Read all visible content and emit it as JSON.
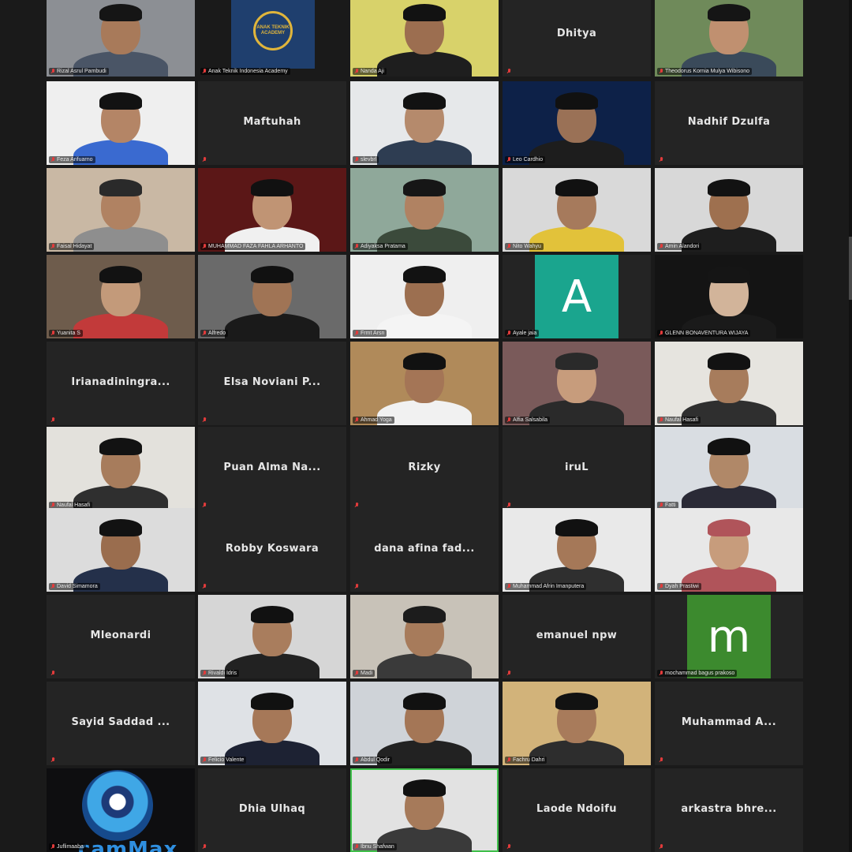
{
  "gallery": {
    "participants": [
      {
        "name": "Rizal Asrul Pambudi",
        "video": true,
        "bg": "#8c8f94",
        "skin": "#a87a5a",
        "shirt": "#4a5566",
        "hair": "#151515"
      },
      {
        "name": "Anak Teknik Indonesia Academy",
        "video": true,
        "logo": true,
        "logo_text": "ANAK TEKNIK ACADEMY",
        "bg": "#1a1a1a"
      },
      {
        "name": "Nanda Aji",
        "video": true,
        "bg": "#d8d26a",
        "skin": "#9c6e50",
        "shirt": "#1e1e1e",
        "hair": "#121212"
      },
      {
        "display": "Dhitya",
        "video": false
      },
      {
        "name": "Theodorus Kornia Mulya Wibisono",
        "video": true,
        "bg": "#6f8a5a",
        "skin": "#c09070",
        "shirt": "#3a4a5a",
        "hair": "#151515"
      },
      {
        "name": "Feza Arifuarno",
        "video": true,
        "bg": "#efefef",
        "skin": "#b48566",
        "shirt": "#3a6ad0",
        "hair": "#121212"
      },
      {
        "display": "Maftuhah",
        "video": false
      },
      {
        "name": "slevbrl",
        "video": true,
        "bg": "#e6e8ea",
        "skin": "#b58a6c",
        "shirt": "#2e3d52",
        "hair": "#121212"
      },
      {
        "name": "Leo Cardhio",
        "video": true,
        "bg": "#0d2148",
        "skin": "#9a7156",
        "shirt": "#1d1d1d",
        "hair": "#111"
      },
      {
        "display": "Nadhif Dzulfa",
        "video": false
      },
      {
        "name": "Faisal Hidayat",
        "video": true,
        "bg": "#c9b8a4",
        "skin": "#b08262",
        "shirt": "#8e8e8e",
        "hair": "#2a2a2a"
      },
      {
        "name": "MUHAMMAD FAZA FAHLA ARHANTO",
        "video": true,
        "bg": "#5b1717",
        "skin": "#c09474",
        "shirt": "#f0f0f0",
        "hair": "#111"
      },
      {
        "name": "Adiyaksa Pratama",
        "video": true,
        "bg": "#8fa89a",
        "skin": "#b08262",
        "shirt": "#3b4a3b",
        "hair": "#161616"
      },
      {
        "name": "Nito Wahyu",
        "video": true,
        "bg": "#d9d9d9",
        "skin": "#a67a5c",
        "shirt": "#e2c23a",
        "hair": "#111"
      },
      {
        "name": "Amin Alandori",
        "video": true,
        "bg": "#d8d8d8",
        "skin": "#9e704f",
        "shirt": "#1e1e1e",
        "hair": "#121212"
      },
      {
        "name": "Yuanita S",
        "video": true,
        "bg": "#6e5c4c",
        "skin": "#c39a7a",
        "shirt": "#c23a3a",
        "hair": "#121212"
      },
      {
        "name": "Alfredo",
        "video": true,
        "bg": "#6a6a6a",
        "skin": "#a07455",
        "shirt": "#1a1a1a",
        "hair": "#111"
      },
      {
        "name": "Frmt Arsn",
        "video": true,
        "bg": "#efefef",
        "skin": "#9c6f50",
        "shirt": "#f4f4f4",
        "hair": "#121212"
      },
      {
        "name": "Ayale jaia",
        "video": true,
        "avatar": "A",
        "avatar_bg": "#1aa58e"
      },
      {
        "name": "GLENN BONAVENTURA WIJAYA",
        "video": true,
        "bg": "#141414",
        "skin": "#d2b49a",
        "shirt": "#1a1a1a",
        "hair": "#151515"
      },
      {
        "display": "Irianadiningra...",
        "video": false
      },
      {
        "display": "Elsa Noviani P...",
        "video": false
      },
      {
        "name": "Ahmad Yoga",
        "video": true,
        "bg": "#b08a5a",
        "skin": "#a47556",
        "shirt": "#f1f1f1",
        "hair": "#111"
      },
      {
        "name": "Alfia Salsabila",
        "video": true,
        "bg": "#7a5a5a",
        "skin": "#c79c7c",
        "shirt": "#2a2a2a",
        "hair": "#2a2a2a"
      },
      {
        "name": "Naufal Hasafi",
        "video": true,
        "bg": "#e6e4df",
        "skin": "#a77c5c",
        "shirt": "#2f2f2f",
        "hair": "#121212"
      },
      {
        "name": "Naufal Hasafi",
        "video": true,
        "bg": "#e3e1dc",
        "skin": "#a77c5c",
        "shirt": "#2f2f2f",
        "hair": "#121212"
      },
      {
        "display": "Puan Alma Na...",
        "video": false
      },
      {
        "display": "Rizky",
        "video": false
      },
      {
        "display": "iruL",
        "video": false
      },
      {
        "name": "Fatti",
        "video": true,
        "bg": "#d9dde2",
        "skin": "#b08868",
        "shirt": "#2a2a36",
        "hair": "#111"
      },
      {
        "name": "David Simamora",
        "video": true,
        "bg": "#dcdcdc",
        "skin": "#9a6d4e",
        "shirt": "#24304a",
        "hair": "#121212"
      },
      {
        "display": "Robby Koswara",
        "video": false
      },
      {
        "display": "dana afina fad...",
        "video": false
      },
      {
        "name": "Muhammad Afrin Imanputera",
        "video": true,
        "bg": "#e9e9e9",
        "skin": "#a57858",
        "shirt": "#2f2f2f",
        "hair": "#111"
      },
      {
        "name": "Dyah Prastiwi",
        "video": true,
        "bg": "#e8e8e8",
        "skin": "#c79c7c",
        "shirt": "#b0545a",
        "hair": "#b0545a"
      },
      {
        "display": "Mleonardi",
        "video": false
      },
      {
        "name": "Rivaldi Idris",
        "video": true,
        "bg": "#d6d6d6",
        "skin": "#a97d5d",
        "shirt": "#222",
        "hair": "#111"
      },
      {
        "name": "Madi",
        "video": true,
        "bg": "#c8c2b8",
        "skin": "#a77b5b",
        "shirt": "#3a3a3a",
        "hair": "#1c1c1c"
      },
      {
        "display": "emanuel npw",
        "video": false
      },
      {
        "name": "mochammad bagus prakoso",
        "video": true,
        "avatar": "m",
        "avatar_bg": "#3c8a2e"
      },
      {
        "display": "Sayid Saddad ...",
        "video": false
      },
      {
        "name": "Felicio Valente",
        "video": true,
        "bg": "#dfe2e6",
        "skin": "#a67858",
        "shirt": "#1d2233",
        "hair": "#111"
      },
      {
        "name": "Abdul Qodir",
        "video": true,
        "bg": "#cfd3d8",
        "skin": "#a47656",
        "shirt": "#222",
        "hair": "#111"
      },
      {
        "name": "Fachru Dahri",
        "video": true,
        "bg": "#d2b37a",
        "skin": "#a87b5b",
        "shirt": "#2d2d2d",
        "hair": "#121212"
      },
      {
        "display": "Muhammad A...",
        "video": false
      },
      {
        "name": "Juflimaaba",
        "video": true,
        "webcam": true,
        "webcam_text": "camMax",
        "bg": "#0e0e10"
      },
      {
        "display": "Dhia Ulhaq",
        "video": false
      },
      {
        "name": "Ibnu Shafwan",
        "video": true,
        "speaking": true,
        "bg": "#e2e2e2",
        "skin": "#a67a5a",
        "shirt": "#3a3a3a",
        "hair": "#111"
      },
      {
        "display": "Laode Ndoifu",
        "video": false
      },
      {
        "display": "arkastra bhre...",
        "video": false
      }
    ]
  },
  "colors": {
    "background": "#1a1a1a",
    "tile": "#242424",
    "muted_mic": "#e23b3b",
    "active_speaker": "#3fbf4a"
  }
}
